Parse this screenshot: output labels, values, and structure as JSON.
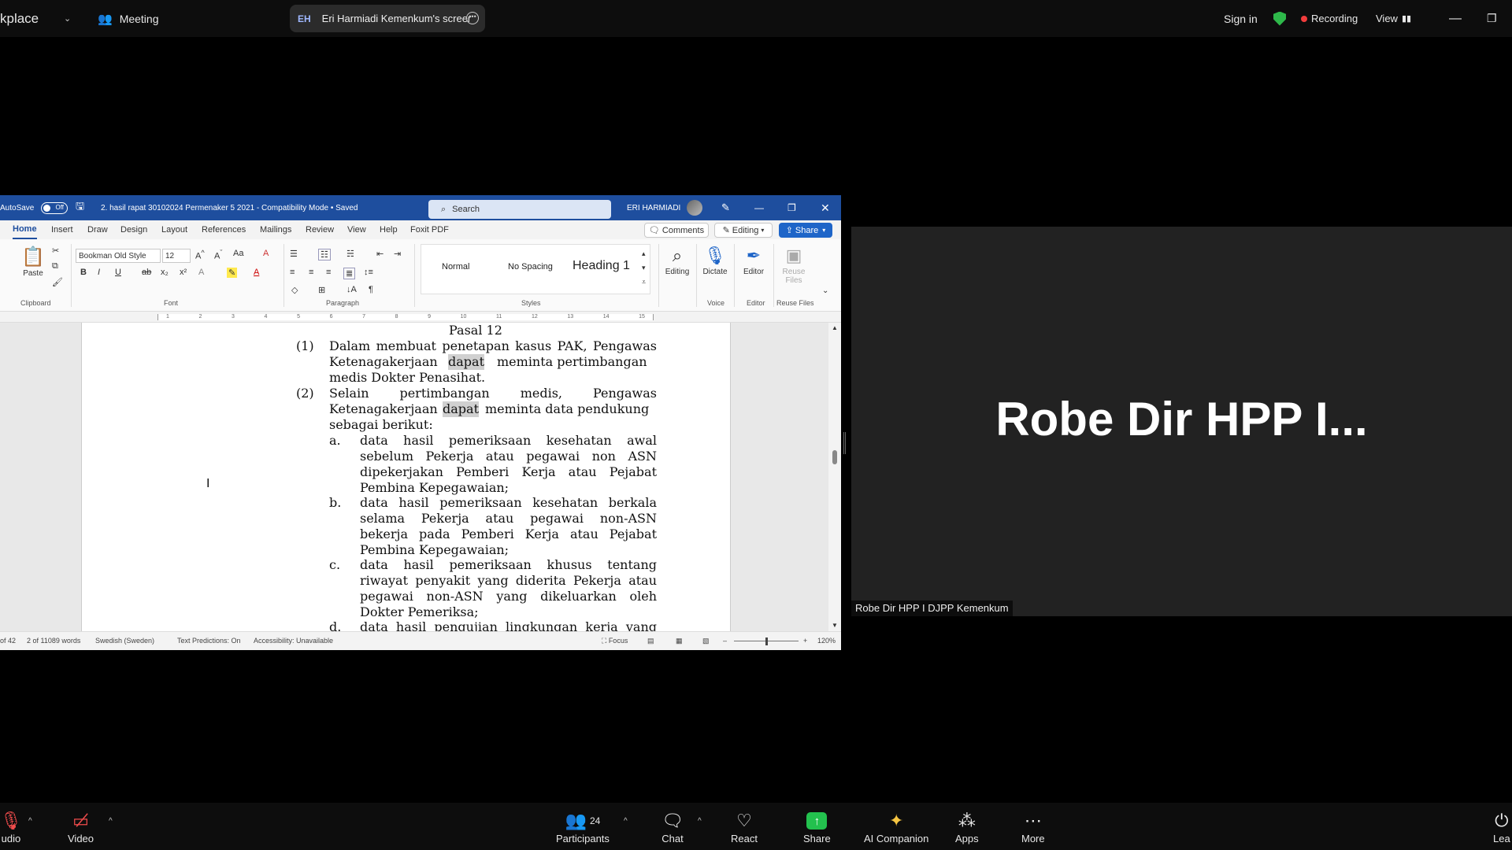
{
  "topbar": {
    "brand": "kplace",
    "meeting_label": "Meeting",
    "share_initials": "EH",
    "share_title": "Eri Harmiadi Kemenkum's screer",
    "sign_in": "Sign in",
    "recording": "Recording",
    "view": "View"
  },
  "word": {
    "autosave_label": "AutoSave",
    "autosave_state": "Off",
    "doc_title": "2. hasil rapat 30102024 Permenaker 5 2021 - Compatibility Mode • Saved",
    "search_placeholder": "Search",
    "user_name": "ERI HARMIADI",
    "tabs": [
      "Home",
      "Insert",
      "Draw",
      "Design",
      "Layout",
      "References",
      "Mailings",
      "Review",
      "View",
      "Help",
      "Foxit PDF"
    ],
    "comments_btn": "Comments",
    "editing_btn": "Editing",
    "share_btn": "Share",
    "ribbon": {
      "paste": "Paste",
      "font_name": "Bookman Old Style",
      "font_size": "12",
      "styles": [
        "Normal",
        "No Spacing",
        "Heading 1"
      ],
      "editing": "Editing",
      "dictate": "Dictate",
      "editor": "Editor",
      "reuse_files": "Reuse Files",
      "groups": [
        "Clipboard",
        "Font",
        "Paragraph",
        "Styles",
        "Voice",
        "Editor",
        "Reuse Files"
      ]
    },
    "ruler_numbers": [
      "1",
      "2",
      "3",
      "4",
      "5",
      "6",
      "7",
      "8",
      "9",
      "10",
      "11",
      "12",
      "13",
      "14",
      "15"
    ],
    "doc_lines": [
      "Pasal 12",
      "(1)",
      "Dalam membuat penetapan kasus PAK, Pengawas",
      "Ketenagakerjaan",
      "dapat",
      "meminta pertimbangan",
      "medis Dokter Penasihat.",
      "(2)",
      "Selain pertimbangan medis, Pengawas",
      "Ketenagakerjaan",
      "dapat",
      "meminta data pendukung",
      "sebagai berikut:",
      "a.",
      "data hasil pemeriksaan kesehatan awal",
      "sebelum Pekerja atau pegawai non ASN",
      "dipekerjakan Pemberi Kerja atau Pejabat",
      "Pembina Kepegawaian;",
      "b.",
      "data hasil pemeriksaan kesehatan berkala",
      "selama Pekerja atau pegawai non-ASN",
      "bekerja pada Pemberi Kerja atau Pejabat",
      "Pembina Kepegawaian;",
      "c.",
      "data hasil pemeriksaan khusus tentang",
      "riwayat penyakit yang diderita Pekerja atau",
      "pegawai non-ASN yang dikeluarkan oleh",
      "Dokter Pemeriksa;",
      "d.",
      "data hasil pengujian lingkungan kerja yang"
    ],
    "status": {
      "page": "of 42",
      "words": "2 of 11089 words",
      "language": "Swedish (Sweden)",
      "predictions": "Text Predictions: On",
      "accessibility": "Accessibility: Unavailable",
      "focus": "Focus",
      "zoom": "120%"
    }
  },
  "tile": {
    "display_name": "Robe Dir HPP I...",
    "label": "Robe Dir HPP I DJPP Kemenkum"
  },
  "bottombar": {
    "audio": "udio",
    "video": "Video",
    "participants": "Participants",
    "participants_count": "24",
    "chat": "Chat",
    "react": "React",
    "share": "Share",
    "ai_companion": "AI Companion",
    "apps": "Apps",
    "more": "More",
    "leave": "Lea"
  }
}
